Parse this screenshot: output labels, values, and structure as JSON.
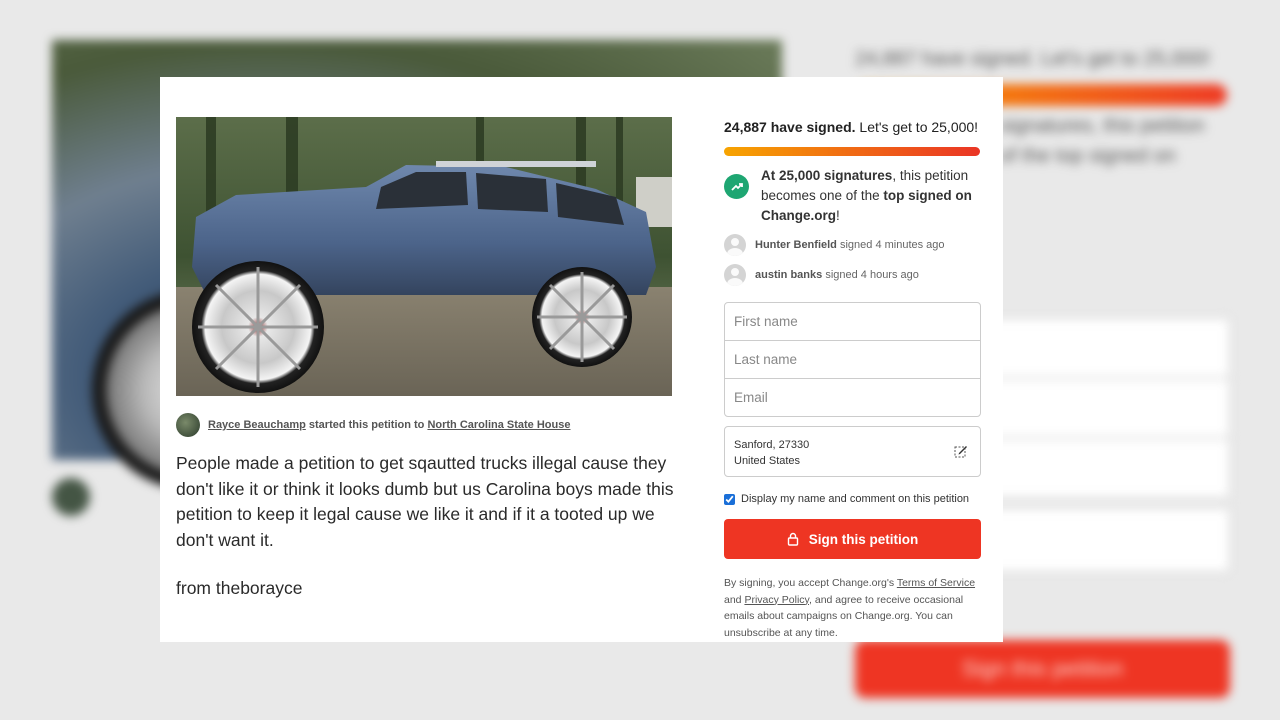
{
  "background": {
    "lines_right": [
      "24,887 have signed. Let's get to 25,000!",
      "signatures, this petition",
      "of the top signed on"
    ],
    "button_label": "Sign this petition"
  },
  "petition": {
    "starter_name": "Rayce Beauchamp",
    "started_text": "started this petition to",
    "target": "North Carolina State House",
    "description": "People made a petition to get sqautted trucks illegal cause they don't like it or think it looks dumb but us Carolina boys made this petition to keep it legal cause we like it and if it a tooted up we don't want it.",
    "from": "from theborayce"
  },
  "signing": {
    "count": "24,887 have signed.",
    "goal_text": "Let's get to 25,000!",
    "progress_fraction": 0.995,
    "milestone_bold": "At 25,000 signatures",
    "milestone_mid": ", this petition becomes one of the ",
    "milestone_bold2": "top signed on Change.org",
    "milestone_end": "!",
    "recent_signers": [
      {
        "name": "Hunter Benfield",
        "time": "signed 4 minutes ago"
      },
      {
        "name": "austin banks",
        "time": "signed 4 hours ago"
      }
    ],
    "first_name_placeholder": "First name",
    "last_name_placeholder": "Last name",
    "email_placeholder": "Email",
    "location_line1": "Sanford, 27330",
    "location_line2": "United States",
    "display_checkbox_label": "Display my name and comment on this petition",
    "display_checked": true,
    "sign_button": "Sign this petition",
    "legal_prefix": "By signing, you accept Change.org's ",
    "terms_link": "Terms of Service",
    "legal_and": " and ",
    "privacy_link": "Privacy Policy",
    "legal_suffix": ", and agree to receive occasional emails about campaigns on Change.org. You can unsubscribe at any time."
  },
  "colors": {
    "accent_red": "#ee3523",
    "success_green": "#1ea672",
    "progress_start": "#f7a400",
    "progress_end": "#ea3525"
  }
}
